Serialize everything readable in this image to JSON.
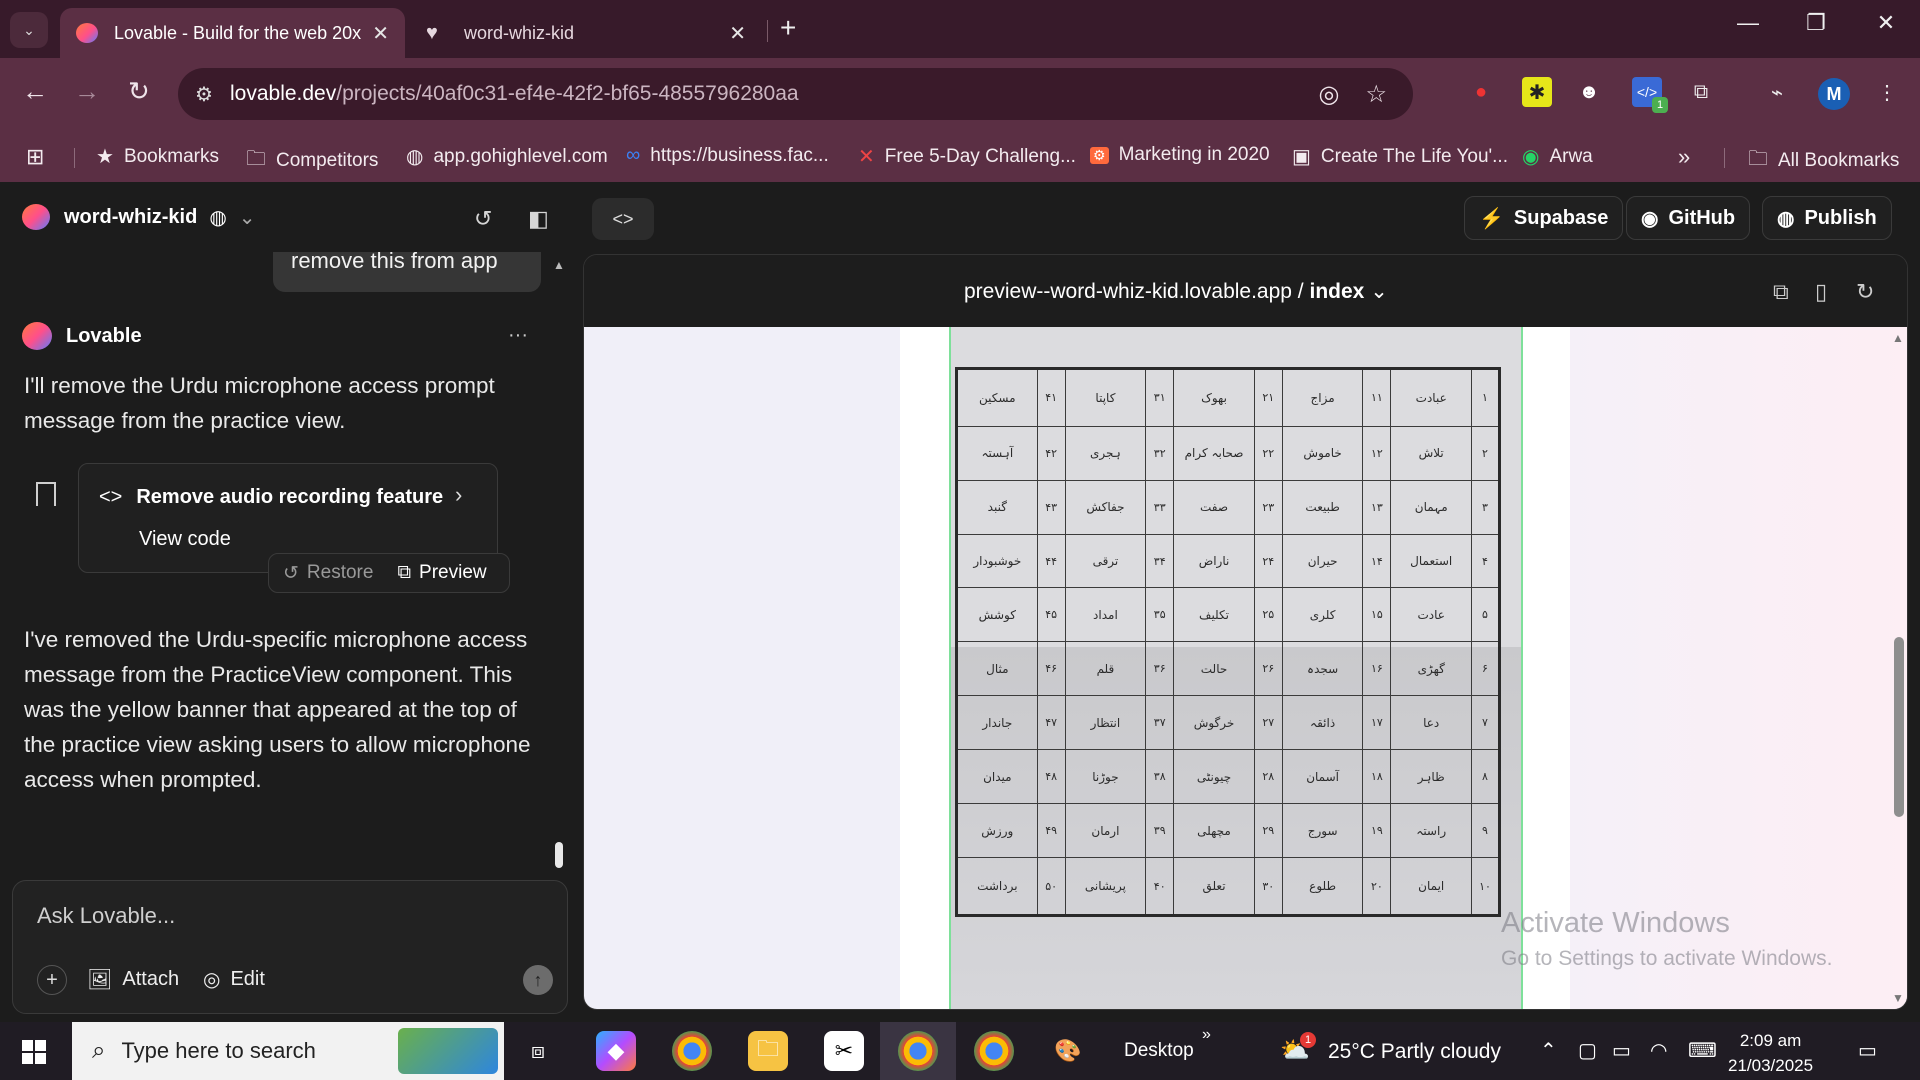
{
  "browser": {
    "tabs": [
      {
        "title": "Lovable - Build for the web 20x",
        "active": true,
        "favicon": "lovable-heart-icon"
      },
      {
        "title": "word-whiz-kid",
        "active": false,
        "favicon": "heart-icon"
      }
    ],
    "url_host": "lovable.dev",
    "url_path": "/projects/40af0c31-ef4e-42f2-bf65-4855796280aa",
    "bookmarks": [
      {
        "label": "Bookmarks",
        "icon": "star-icon"
      },
      {
        "label": "Competitors",
        "icon": "folder-icon"
      },
      {
        "label": "app.gohighlevel.com",
        "icon": "globe-icon"
      },
      {
        "label": "https://business.fac...",
        "icon": "meta-icon"
      },
      {
        "label": "Free 5-Day Challeng...",
        "icon": "site-icon"
      },
      {
        "label": "Marketing in 2020",
        "icon": "site-icon"
      },
      {
        "label": "Create The Life You'...",
        "icon": "site-icon"
      },
      {
        "label": "Arwa",
        "icon": "whatsapp-icon"
      }
    ],
    "all_bookmarks": "All Bookmarks",
    "profile_initial": "M",
    "extension_badge": "1"
  },
  "app": {
    "project_name": "word-whiz-kid",
    "buttons": {
      "supabase": "Supabase",
      "github": "GitHub",
      "publish": "Publish"
    }
  },
  "chat": {
    "user_message": "remove this from app",
    "author": "Lovable",
    "reply_1": "I'll remove the Urdu microphone access prompt message from the practice view.",
    "card": {
      "title": "Remove audio recording feature",
      "view_code": "View code"
    },
    "actions": {
      "restore": "Restore",
      "preview": "Preview"
    },
    "reply_2": "I've removed the Urdu-specific microphone access message from the PracticeView component. This was the yellow banner that appeared at the top of the practice view asking users to allow microphone access when prompted.",
    "input_placeholder": "Ask Lovable...",
    "attach": "Attach",
    "edit": "Edit"
  },
  "preview": {
    "host": "preview--word-whiz-kid.lovable.app",
    "route": "index",
    "worksheet_rows": [
      [
        "۱",
        "عبادت",
        "۱۱",
        "مزاج",
        "۲۱",
        "بھوک",
        "۳۱",
        "کاپتا",
        "۴۱",
        "مسکین"
      ],
      [
        "۲",
        "تلاش",
        "۱۲",
        "خاموش",
        "۲۲",
        "صحابہ کرام",
        "۳۲",
        "ہجری",
        "۴۲",
        "آہستہ"
      ],
      [
        "۳",
        "مہمان",
        "۱۳",
        "طبیعت",
        "۲۳",
        "صفت",
        "۳۳",
        "جفاکش",
        "۴۳",
        "گنبد"
      ],
      [
        "۴",
        "استعمال",
        "۱۴",
        "حیران",
        "۲۴",
        "ناراض",
        "۳۴",
        "ترقی",
        "۴۴",
        "خوشبودار"
      ],
      [
        "۵",
        "عادت",
        "۱۵",
        "کلری",
        "۲۵",
        "تکلیف",
        "۳۵",
        "امداد",
        "۴۵",
        "کوشش"
      ],
      [
        "۶",
        "گھڑی",
        "۱۶",
        "سجدہ",
        "۲۶",
        "حالت",
        "۳۶",
        "قلم",
        "۴۶",
        "مثال"
      ],
      [
        "۷",
        "دعا",
        "۱۷",
        "ذائقہ",
        "۲۷",
        "خرگوش",
        "۳۷",
        "انتظار",
        "۴۷",
        "جاندار"
      ],
      [
        "۸",
        "ظاہر",
        "۱۸",
        "آسمان",
        "۲۸",
        "چیونٹی",
        "۳۸",
        "جوڑنا",
        "۴۸",
        "میدان"
      ],
      [
        "۹",
        "راستہ",
        "۱۹",
        "سورج",
        "۲۹",
        "مچھلی",
        "۳۹",
        "ارمان",
        "۴۹",
        "ورزش"
      ],
      [
        "۱۰",
        "ایمان",
        "۲۰",
        "طلوع",
        "۳۰",
        "تعلق",
        "۴۰",
        "پریشانی",
        "۵۰",
        "برداشت"
      ]
    ],
    "watermark_title": "Activate Windows",
    "watermark_sub": "Go to Settings to activate Windows."
  },
  "taskbar": {
    "search_placeholder": "Type here to search",
    "desktop_label": "Desktop",
    "weather": "25°C  Partly cloudy",
    "weather_badge": "1",
    "time": "2:09 am",
    "date": "21/03/2025"
  }
}
